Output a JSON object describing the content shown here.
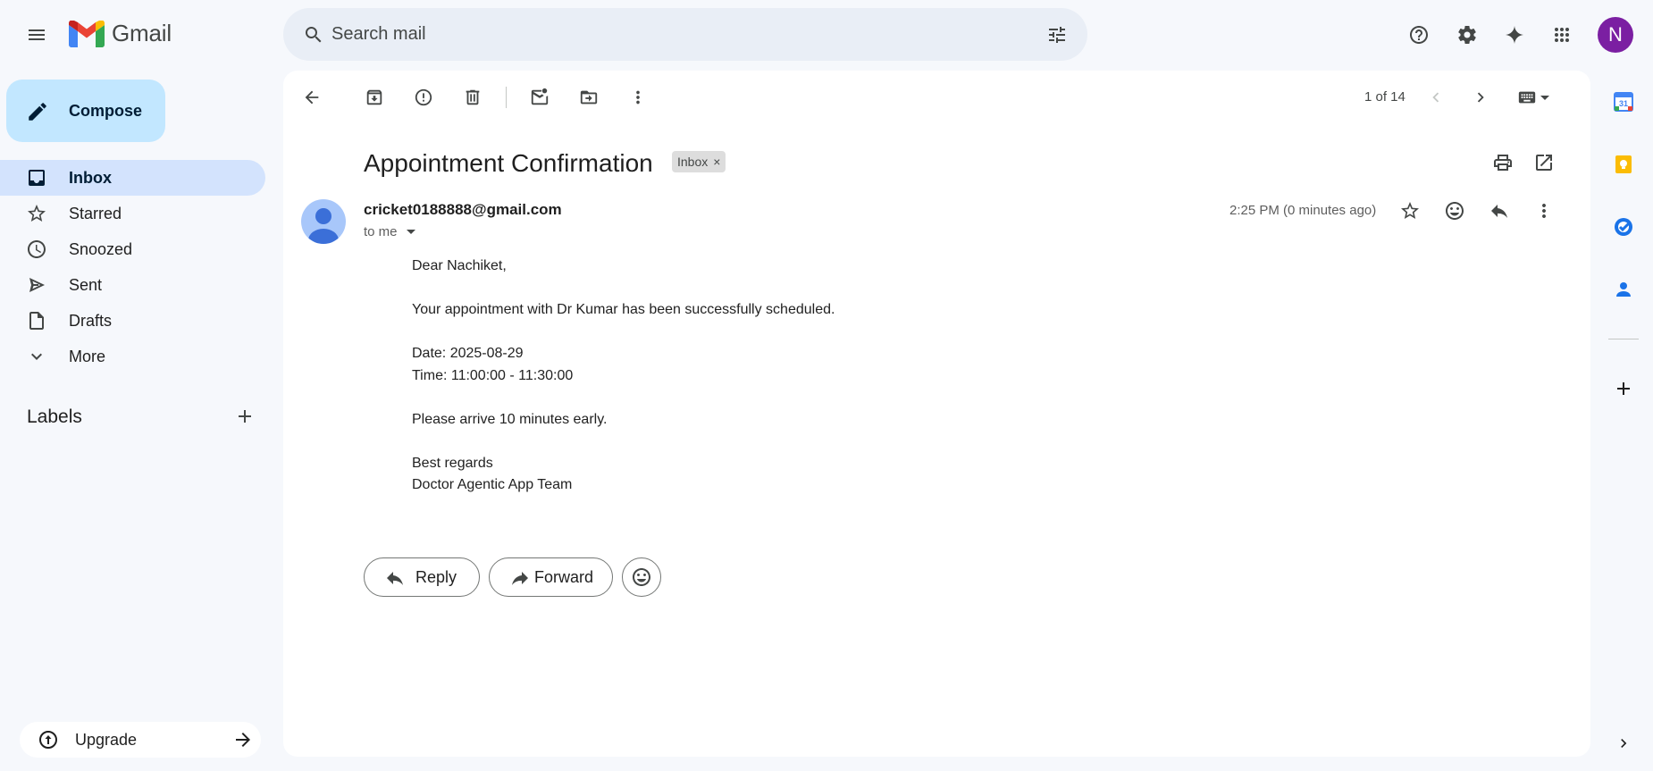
{
  "header": {
    "app_name": "Gmail",
    "search_placeholder": "Search mail",
    "avatar_initial": "N"
  },
  "sidebar": {
    "compose_label": "Compose",
    "items": [
      {
        "label": "Inbox",
        "icon": "inbox-icon",
        "active": true
      },
      {
        "label": "Starred",
        "icon": "star-icon"
      },
      {
        "label": "Snoozed",
        "icon": "clock-icon"
      },
      {
        "label": "Sent",
        "icon": "send-icon"
      },
      {
        "label": "Drafts",
        "icon": "draft-icon"
      },
      {
        "label": "More",
        "icon": "chevron-down-icon"
      }
    ],
    "labels_title": "Labels",
    "upgrade_label": "Upgrade"
  },
  "toolbar": {
    "pager": "1 of 14"
  },
  "email": {
    "subject": "Appointment Confirmation",
    "label_chip": "Inbox",
    "label_chip_remove": "×",
    "sender": "cricket0188888@gmail.com",
    "recipient_line": "to me",
    "timestamp": "2:25 PM (0 minutes ago)",
    "body_lines": [
      "Dear Nachiket,",
      "",
      "Your appointment with Dr Kumar has been successfully scheduled.",
      "",
      "Date: 2025-08-29",
      "Time: 11:00:00 - 11:30:00",
      "",
      "Please arrive 10 minutes early.",
      "",
      "Best regards",
      "Doctor Agentic App Team"
    ],
    "reply_label": "Reply",
    "forward_label": "Forward"
  },
  "side_panel": {
    "calendar_day": "31"
  },
  "colors": {
    "background": "#f6f8fc",
    "compose": "#c2e7ff",
    "active_nav": "#d3e3fd",
    "search_bg": "#e9eef6",
    "avatar": "#7b1fa2"
  }
}
